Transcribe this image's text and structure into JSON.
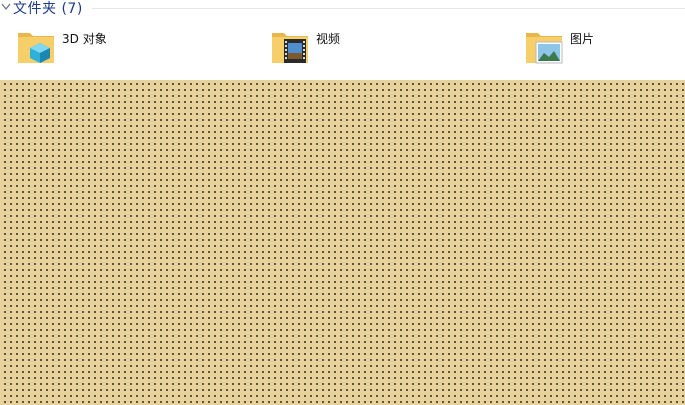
{
  "group": {
    "title": "文件夹 (7)"
  },
  "items": [
    {
      "label": "3D 对象",
      "icon": "3d-objects-folder-icon"
    },
    {
      "label": "视频",
      "icon": "videos-folder-icon"
    },
    {
      "label": "图片",
      "icon": "pictures-folder-icon"
    }
  ],
  "colors": {
    "folder": "#f3c65b",
    "header_text": "#1e3a8a",
    "overlay": "#e8d29b"
  }
}
